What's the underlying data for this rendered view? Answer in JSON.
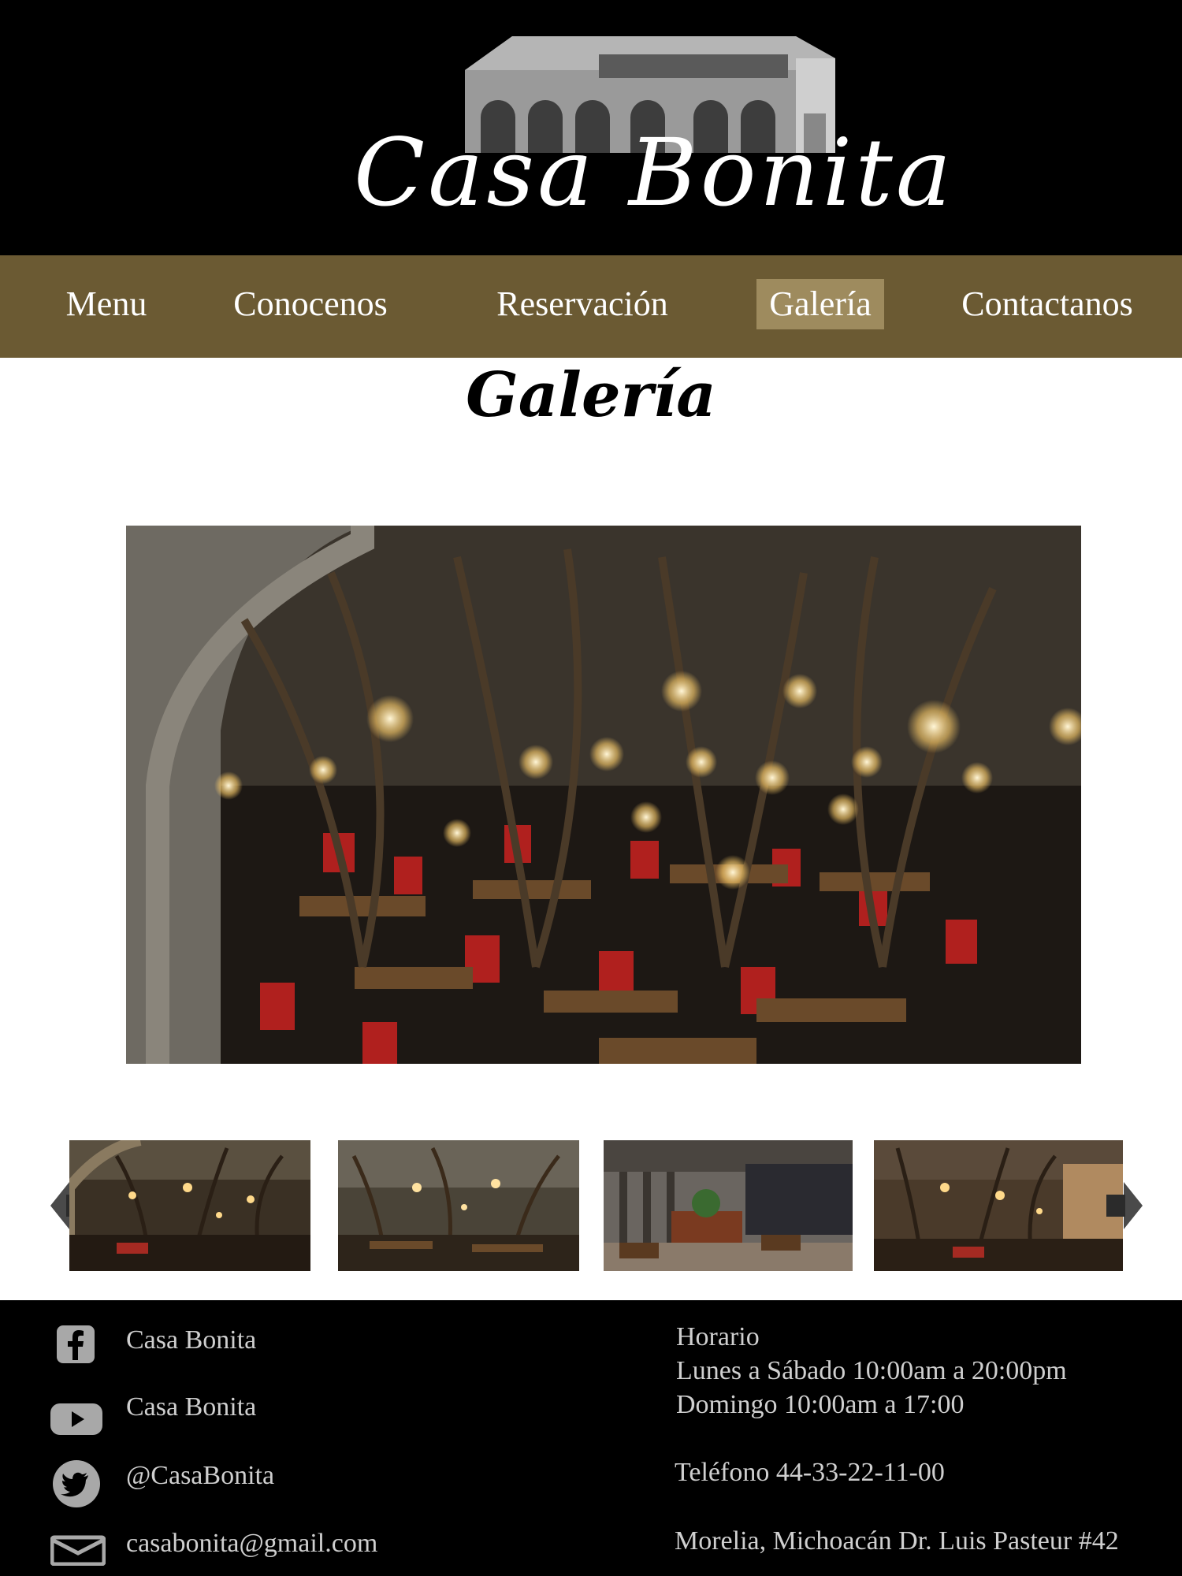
{
  "header": {
    "brand": "Casa Bonita"
  },
  "nav": {
    "items": [
      {
        "label": "Menu"
      },
      {
        "label": "Conocenos"
      },
      {
        "label": "Reservación"
      },
      {
        "label": "Galería",
        "active": true
      },
      {
        "label": "Contactanos"
      }
    ]
  },
  "page": {
    "title": "Galería"
  },
  "gallery": {
    "thumbnail_count": 4
  },
  "footer": {
    "social": [
      {
        "icon": "facebook-icon",
        "label": "Casa Bonita"
      },
      {
        "icon": "youtube-icon",
        "label": "Casa Bonita"
      },
      {
        "icon": "twitter-icon",
        "label": "@CasaBonita"
      },
      {
        "icon": "mail-icon",
        "label": "casabonita@gmail.com"
      }
    ],
    "hours_title": "Horario",
    "hours_weekdays": "Lunes a Sábado 10:00am a 20:00pm",
    "hours_sunday": "Domingo 10:00am a 17:00",
    "phone": "Teléfono 44-33-22-11-00",
    "address": "Morelia, Michoacán Dr. Luis Pasteur #42"
  },
  "colors": {
    "nav_bg": "#6b5a33",
    "nav_active": "#9e8b5e",
    "header_bg": "#000000"
  }
}
